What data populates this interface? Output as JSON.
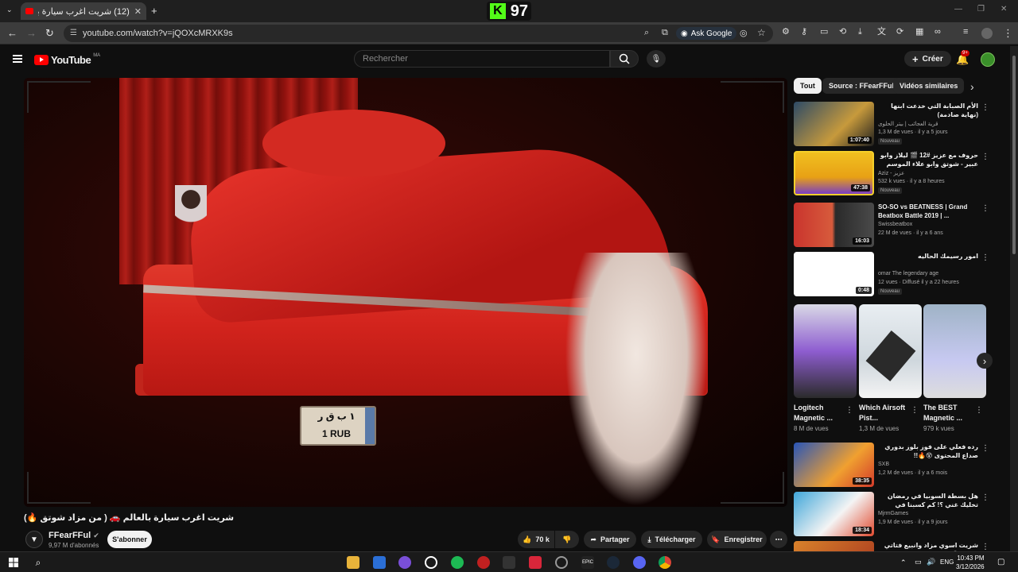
{
  "browser": {
    "tab_title": "(12) شريت اغرب سيارة بالعالم 🚗",
    "url": "youtube.com/watch?v=jQOXcMRXK9s",
    "ask_google": "Ask Google",
    "kick_count": "97"
  },
  "youtube": {
    "logo_text": "YouTube",
    "country_code": "MA",
    "search_placeholder": "Rechercher",
    "create_label": "Créer",
    "notif_badge": "9+"
  },
  "video": {
    "title": "شريت اغرب سيارة بالعالم 🚗 ( من مزاد شوتق 🔥)",
    "plate_top": "١ ب ق ر",
    "plate_bottom": "1 RUB",
    "channel": {
      "name": "FFearFFul",
      "subscribers": "9,97 M d'abonnés",
      "subscribe_label": "S'abonner"
    },
    "actions": {
      "likes": "70 k",
      "share": "Partager",
      "download": "Télécharger",
      "save": "Enregistrer"
    }
  },
  "sidebar": {
    "chips": [
      "Tout",
      "Source : FFearFFul",
      "Vidéos similaires"
    ],
    "recs": [
      {
        "title": "الأم الصبابة التي خدعت ابنها (نهاية صادمة)",
        "channel": "قرية العجائب | بيتر الحلوى",
        "meta": "1,3 M de vues · il y a 5 jours",
        "duration": "1:07:40",
        "badge": "Nouveau",
        "rtl": true
      },
      {
        "title": "حروف مع عزيز #12 🎬 ليلاز وابو عبير - شوتق وابو علاء الموسم الثالث 🌙",
        "channel": "Aziz - عزيز",
        "meta": "532 k vues · il y a 8 heures",
        "duration": "47:38",
        "badge": "Nouveau",
        "rtl": true
      },
      {
        "title": "SO-SO vs BEATNESS | Grand Beatbox Battle 2019 | ...",
        "channel": "Swissbeatbox",
        "meta": "22 M de vues · il y a 6 ans",
        "duration": "16:03",
        "badge": "",
        "rtl": false
      },
      {
        "title": "امور رسيمك الحاليه",
        "channel": "omar The legendary age",
        "meta": "12 vues · Diffusé il y a 22 heures",
        "duration": "0:48",
        "badge": "Nouveau",
        "rtl": true
      }
    ],
    "shorts": [
      {
        "title": "Logitech Magnetic ...",
        "views": "8 M de vues"
      },
      {
        "title": "Which Airsoft Pist...",
        "views": "1,3 M de vues"
      },
      {
        "title": "The BEST Magnetic ...",
        "views": "979 k vues"
      }
    ],
    "recs2": [
      {
        "title": "رده فعلي على فوز بلوز بدوري صداع المحتوى 😵🔥!!",
        "channel": "SXB",
        "meta": "1,2 M de vues · il y a 6 mois",
        "duration": "38:35"
      },
      {
        "title": "هل بسطة السوبيا في رمضان تخليك غني ؟! كم كسبنا في ساعة 🔥 !!",
        "channel": "MjrmGames",
        "meta": "1,9 M de vues · il y a 9 jours",
        "duration": "18:34"
      },
      {
        "title": "شريت اسوي مزاد وانبيع فتاتي للجيل 😊",
        "channel": "",
        "meta": "",
        "duration": ""
      }
    ]
  },
  "taskbar": {
    "lang": "ENG",
    "time": "10:43 PM",
    "date": "3/12/2026"
  }
}
